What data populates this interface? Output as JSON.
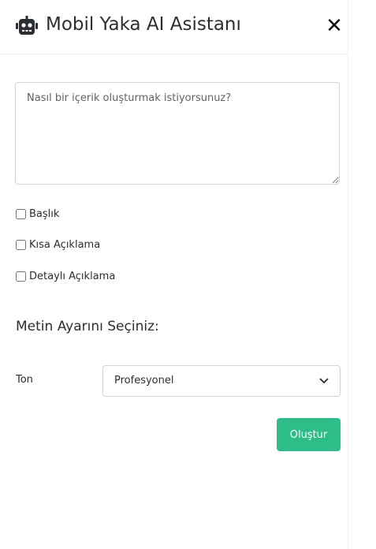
{
  "header": {
    "title": "Mobil Yaka AI Asistanı",
    "close_symbol": "✕",
    "icons": {
      "title_icon": "robot-icon",
      "close_icon": "close-icon"
    }
  },
  "prompt": {
    "placeholder": "Nasıl bir içerik oluşturmak istiyorsunuz?",
    "value": ""
  },
  "options": [
    {
      "label": "Başlık",
      "checked": false
    },
    {
      "label": "Kısa Açıklama",
      "checked": false
    },
    {
      "label": "Detaylı Açıklama",
      "checked": false
    }
  ],
  "settings": {
    "section_title": "Metin Ayarını Seçiniz:",
    "tone_label": "Ton",
    "tone_value": "Profesyonel"
  },
  "actions": {
    "submit_label": "Oluştur"
  },
  "colors": {
    "accent": "#2ebc89",
    "title_text": "#2b2f33",
    "border": "#cfd3d7"
  }
}
